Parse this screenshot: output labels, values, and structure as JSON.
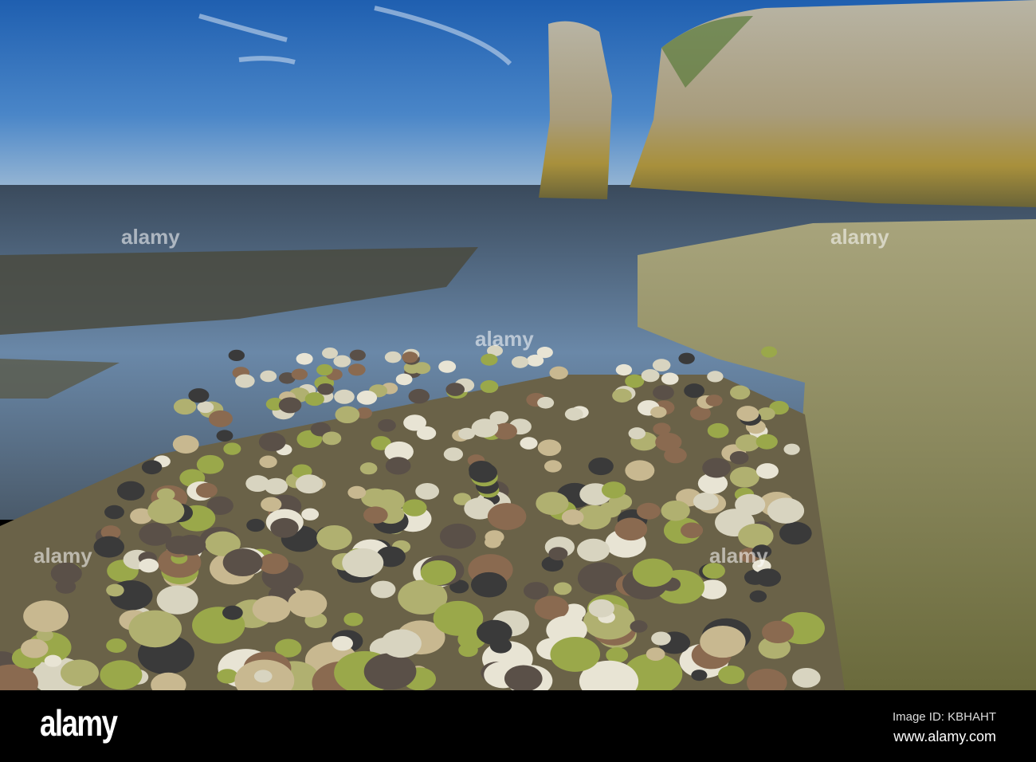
{
  "watermark": {
    "logo": "alamy",
    "overlay": "alamy"
  },
  "footer": {
    "image_id": "Image ID: KBHAHT",
    "url": "www.alamy.com"
  }
}
